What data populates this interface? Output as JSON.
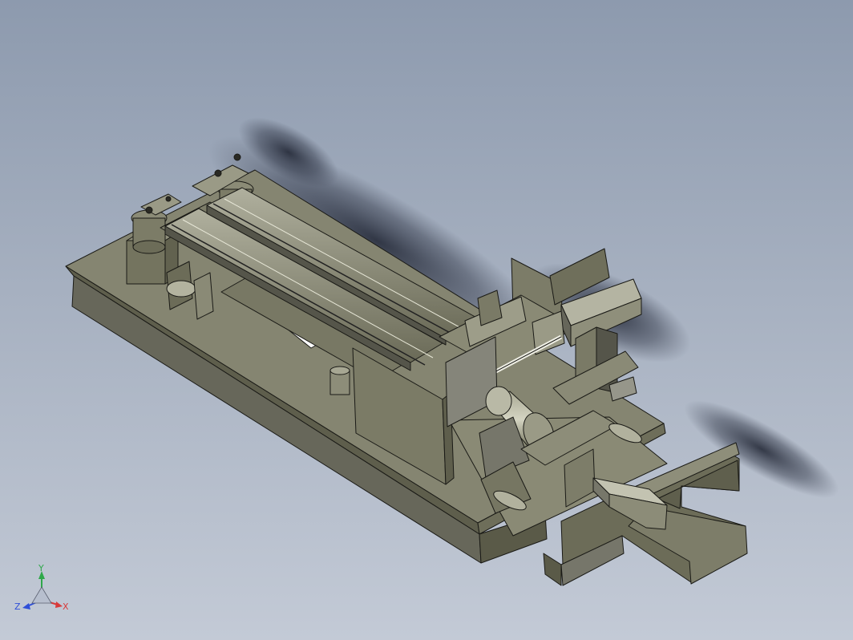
{
  "viewport": {
    "background_top": "#8d9aae",
    "background_bottom": "#c3cad6",
    "model_color": "#7a7a66",
    "edge_color": "#1a1a16"
  },
  "triad": {
    "y_label": "Y",
    "z_label": "Z",
    "x_label": "X",
    "y_color": "#2fa84a",
    "x_color": "#d83a3a",
    "z_color": "#2f4fd8"
  }
}
